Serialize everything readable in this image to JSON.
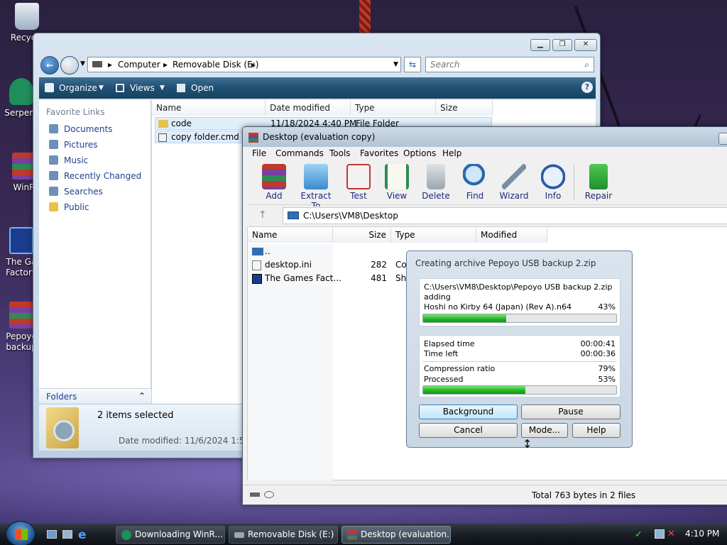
{
  "desktop": {
    "icons": [
      {
        "label": "Recycle"
      },
      {
        "label": "Serpent"
      },
      {
        "label": "WinR"
      },
      {
        "label": "The Ga Factory"
      },
      {
        "label": "Pepoyo backup"
      }
    ]
  },
  "explorer": {
    "address": {
      "segments": [
        "Computer",
        "Removable Disk (E:)"
      ]
    },
    "search_placeholder": "Search",
    "toolbar": {
      "organize": "Organize",
      "views": "Views",
      "open": "Open"
    },
    "favorite_links_title": "Favorite Links",
    "links": [
      "Documents",
      "Pictures",
      "Music",
      "Recently Changed",
      "Searches",
      "Public"
    ],
    "folders_label": "Folders",
    "columns": [
      "Name",
      "Date modified",
      "Type",
      "Size"
    ],
    "files": [
      {
        "name": "code",
        "date": "11/18/2024 4:40 PM",
        "type": "File Folder"
      },
      {
        "name": "copy folder.cmd"
      }
    ],
    "details": {
      "selected": "2 items selected",
      "date_modified": "Date modified: 11/6/2024 1:52 PM"
    }
  },
  "winrar": {
    "title": "Desktop (evaluation copy)",
    "menu": [
      "File",
      "Commands",
      "Tools",
      "Favorites",
      "Options",
      "Help"
    ],
    "tools": [
      "Add",
      "Extract To",
      "Test",
      "View",
      "Delete",
      "Find",
      "Wizard",
      "Info",
      "Repair"
    ],
    "path": "C:\\Users\\VM8\\Desktop",
    "columns": [
      "Name",
      "Size",
      "Type",
      "Modified"
    ],
    "files": [
      {
        "name": "..",
        "size": "",
        "type": ""
      },
      {
        "name": "desktop.ini",
        "size": "282",
        "type": "Co"
      },
      {
        "name": "The Games Fact...",
        "size": "481",
        "type": "Sho"
      }
    ],
    "status": "Total 763 bytes in 2 files"
  },
  "progress_dialog": {
    "title": "Creating archive Pepoyo USB backup 2.zip",
    "archive_path": "C:\\Users\\VM8\\Desktop\\Pepoyo USB backup 2.zip",
    "action": "adding",
    "current_file": "Hoshi no Kirby 64 (Japan) (Rev A).n64",
    "file_percent": "43%",
    "file_progress": 0.43,
    "elapsed_label": "Elapsed time",
    "elapsed_value": "00:00:41",
    "left_label": "Time left",
    "left_value": "00:00:36",
    "ratio_label": "Compression ratio",
    "ratio_value": "79%",
    "processed_label": "Processed",
    "processed_value": "53%",
    "total_progress": 0.53,
    "buttons": {
      "background": "Background",
      "pause": "Pause",
      "cancel": "Cancel",
      "mode": "Mode...",
      "help": "Help"
    }
  },
  "taskbar": {
    "tasks": [
      "Downloading WinR...",
      "Removable Disk (E:)",
      "Desktop (evaluation..."
    ],
    "clock": "4:10 PM"
  },
  "colors": {
    "accent_green": "#1fb51f",
    "link_blue": "#1c3f8f"
  }
}
